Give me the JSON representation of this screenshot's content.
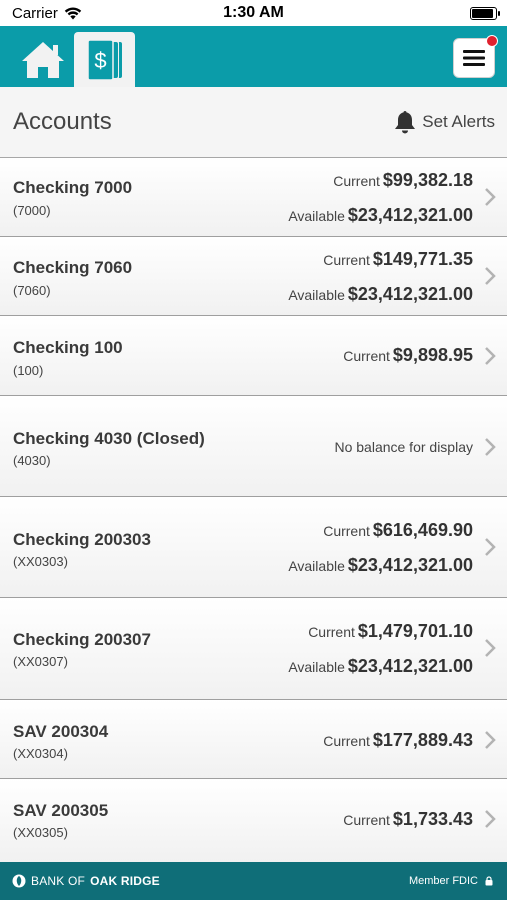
{
  "status_bar": {
    "carrier": "Carrier",
    "time": "1:30 AM"
  },
  "nav": {
    "home_icon": "home-icon",
    "accounts_icon": "dollar-cards-icon",
    "menu_icon": "hamburger-menu-icon",
    "menu_badge_color": "#e0212e",
    "brand_color": "#0b9ca9"
  },
  "header": {
    "title": "Accounts",
    "alerts_label": "Set Alerts",
    "alerts_icon": "bell-icon"
  },
  "accounts": [
    {
      "name": "Checking 7000",
      "number": "(7000)",
      "current_label": "Current",
      "current": "$99,382.18",
      "available_label": "Available",
      "available": "$23,412,321.00"
    },
    {
      "name": "Checking 7060",
      "number": "(7060)",
      "current_label": "Current",
      "current": "$149,771.35",
      "available_label": "Available",
      "available": "$23,412,321.00"
    },
    {
      "name": "Checking 100",
      "number": "(100)",
      "current_label": "Current",
      "current": "$9,898.95"
    },
    {
      "name": "Checking 4030 (Closed)",
      "number": "(4030)",
      "no_balance": "No balance for display"
    },
    {
      "name": "Checking 200303",
      "number": "(XX0303)",
      "current_label": "Current",
      "current": "$616,469.90",
      "available_label": "Available",
      "available": "$23,412,321.00"
    },
    {
      "name": "Checking 200307",
      "number": "(XX0307)",
      "current_label": "Current",
      "current": "$1,479,701.10",
      "available_label": "Available",
      "available": "$23,412,321.00"
    },
    {
      "name": "SAV 200304",
      "number": "(XX0304)",
      "current_label": "Current",
      "current": "$177,889.43"
    },
    {
      "name": "SAV 200305",
      "number": "(XX0305)",
      "current_label": "Current",
      "current": "$1,733.43"
    }
  ],
  "footer": {
    "bank_prefix": "BANK OF",
    "bank_name": "OAK RIDGE",
    "member": "Member FDIC",
    "lock_icon": "lock-icon",
    "brand_color": "#0f6e78"
  }
}
